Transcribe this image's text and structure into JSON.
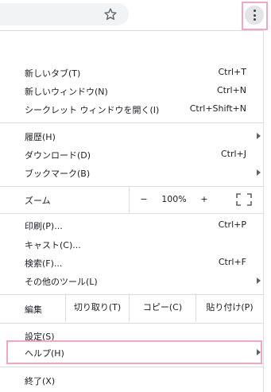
{
  "colors": {
    "highlight": "#f2a6c2",
    "separator": "#dadce0",
    "text": "#202124",
    "omnibox_bg": "#f1f3f4"
  },
  "toolbar": {
    "star_icon": "star-outline-icon",
    "menu_icon": "three-dot-vertical-icon"
  },
  "menu": {
    "group1": [
      {
        "label": "新しいタブ(T)",
        "shortcut": "Ctrl+T"
      },
      {
        "label": "新しいウィンドウ(N)",
        "shortcut": "Ctrl+N"
      },
      {
        "label": "シークレット ウィンドウを開く(I)",
        "shortcut": "Ctrl+Shift+N"
      }
    ],
    "group2": [
      {
        "label": "履歴(H)",
        "shortcut": ""
      },
      {
        "label": "ダウンロード(D)",
        "shortcut": "Ctrl+J"
      },
      {
        "label": "ブックマーク(B)",
        "shortcut": ""
      }
    ],
    "zoom": {
      "label": "ズーム",
      "minus": "−",
      "value": "100%",
      "plus": "+"
    },
    "group3": [
      {
        "label": "印刷(P)...",
        "shortcut": "Ctrl+P"
      },
      {
        "label": "キャスト(C)...",
        "shortcut": ""
      },
      {
        "label": "検索(F)...",
        "shortcut": "Ctrl+F"
      },
      {
        "label": "その他のツール(L)",
        "shortcut": ""
      }
    ],
    "edit": {
      "label": "編集",
      "cut": "切り取り(T)",
      "copy": "コピー(C)",
      "paste": "貼り付け(P)"
    },
    "group4": [
      {
        "label": "設定(S)"
      },
      {
        "label": "ヘルプ(H)"
      }
    ],
    "exit": {
      "label": "終了(X)"
    }
  }
}
